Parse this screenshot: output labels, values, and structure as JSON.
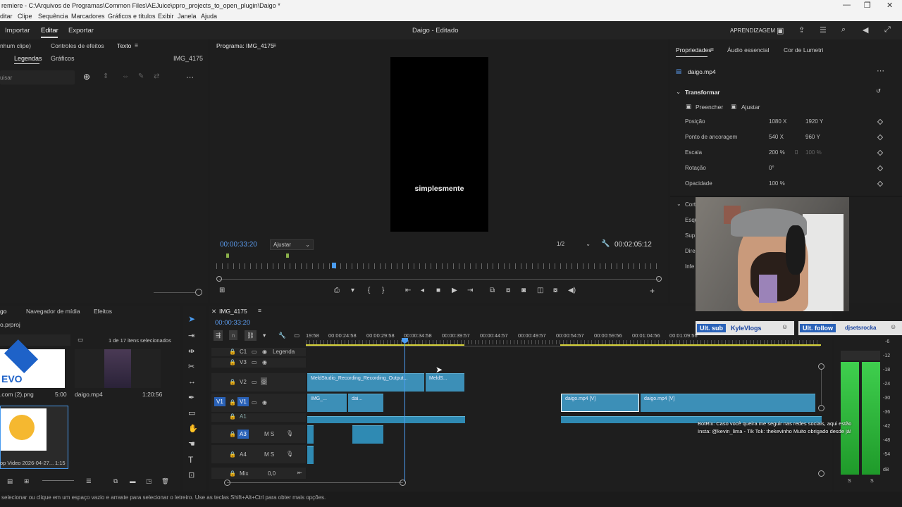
{
  "titlebar": {
    "title": "remiere - C:\\Arquivos de Programas\\Common Files\\AEJuice\\ppro_projects_to_open_plugin\\Daigo *",
    "minimize": "—",
    "maximize": "❐",
    "close": "✕"
  },
  "menu": [
    "ditar",
    "Clipe",
    "Sequência",
    "Marcadores",
    "Gráficos e títulos",
    "Exibir",
    "Janela",
    "Ajuda"
  ],
  "workspace": {
    "tabs": [
      "Importar",
      "Editar",
      "Exportar"
    ],
    "doc_title": "Daigo - Editado",
    "learning": "APRENDIZAGEM"
  },
  "left_panel": {
    "tabs": [
      "nhum clipe)",
      "Controles de efeitos",
      "Texto"
    ],
    "subtabs": [
      "Legendas",
      "Gráficos"
    ],
    "clip_name": "IMG_4175",
    "search_placeholder": "uisar"
  },
  "program": {
    "title": "Programa: IMG_4175",
    "caption": "simplesmente",
    "timecode": "00:00:33:20",
    "fit": "Ajustar",
    "resolution": "1/2",
    "duration": "00:02:05:12"
  },
  "properties": {
    "tabs": [
      "Propriedades",
      "Áudio essencial",
      "Cor de Lumetri"
    ],
    "clip": "daigo.mp4",
    "section": "Transformar",
    "fill": "Preencher",
    "fit": "Ajustar",
    "rows": [
      {
        "label": "Posição",
        "v1": "1080",
        "u1": "X",
        "v2": "1920",
        "u2": "Y"
      },
      {
        "label": "Ponto de ancoragem",
        "v1": "540",
        "u1": "X",
        "v2": "960",
        "u2": "Y"
      },
      {
        "label": "Escala",
        "v1": "200",
        "u1": "%",
        "v2": "100",
        "u2": "%"
      },
      {
        "label": "Rotação",
        "v1": "0",
        "u1": "°",
        "v2": "",
        "u2": ""
      },
      {
        "label": "Opacidade",
        "v1": "100",
        "u1": "%",
        "v2": "",
        "u2": ""
      }
    ],
    "cut_section": "Cort",
    "cut_rows": [
      "Esqu",
      "Sup",
      "Dire",
      "Infe"
    ]
  },
  "project": {
    "tabs": [
      "go",
      "Navegador de mídia",
      "Efeitos"
    ],
    "file": "o.prproj",
    "selection": "1 de 17 itens selecionados",
    "items": [
      {
        "name": ".com (2).png",
        "duration": "5:00"
      },
      {
        "name": "daigo.mp4",
        "duration": "1:20:56"
      },
      {
        "name": "op Video 2026-04-27...",
        "duration": "1:15"
      }
    ],
    "evo_logo": "EVO"
  },
  "timeline": {
    "seq_name": "IMG_4175",
    "timecode": "00:00:33:20",
    "ruler": [
      "19:58",
      "00:00:24:58",
      "00:00:29:58",
      "00:00:34:58",
      "00:00:39:57",
      "00:00:44:57",
      "00:00:49:57",
      "00:00:54:57",
      "00:00:59:56",
      "00:01:04:56",
      "00:01:09:56"
    ],
    "tracks": [
      {
        "id": "C1",
        "name": "Legenda"
      },
      {
        "id": "V3",
        "name": ""
      },
      {
        "id": "V2",
        "name": ""
      },
      {
        "id": "V1",
        "name": ""
      },
      {
        "id": "A1",
        "name": ""
      },
      {
        "id": "A3",
        "name": "M  S"
      },
      {
        "id": "A4",
        "name": "M  S"
      }
    ],
    "mix_label": "Mix",
    "mix_value": "0,0",
    "clips": {
      "v2a": "MeldStudio_Recording_Recording_Output...",
      "v2b": "MeldS...",
      "v1a": "IMG_...",
      "v1b": "dai...",
      "v1c": "daigo.mp4 [V]",
      "v1d": "daigo.mp4 [V]"
    }
  },
  "overlay": {
    "sub_label": "Ult. sub",
    "sub_name": "KyleVlogs",
    "follow_label": "Ult. follow",
    "follow_name": "djsetsrocka",
    "chat_1": "BotRix: Caso você queira me seguir nas redes sociais, aqui estão",
    "chat_2": "Insta: @kevin_lima - Tik Tok: thekevinho Muito obrigado desde já!"
  },
  "meters": [
    "-6",
    "-12",
    "-18",
    "-24",
    "-30",
    "-36",
    "-42",
    "-48",
    "-54",
    "dB"
  ],
  "meter_solo": [
    "S",
    "S"
  ],
  "status": "selecionar ou clique em um espaço vazio e arraste para selecionar o letreiro. Use as teclas Shift+Alt+Ctrl para obter mais opções.",
  "colors": {
    "accent": "#5b9cf0",
    "clip_video": "#3c8fb7",
    "playhead": "#4a9cf0",
    "meter": "#3fcf4e"
  }
}
